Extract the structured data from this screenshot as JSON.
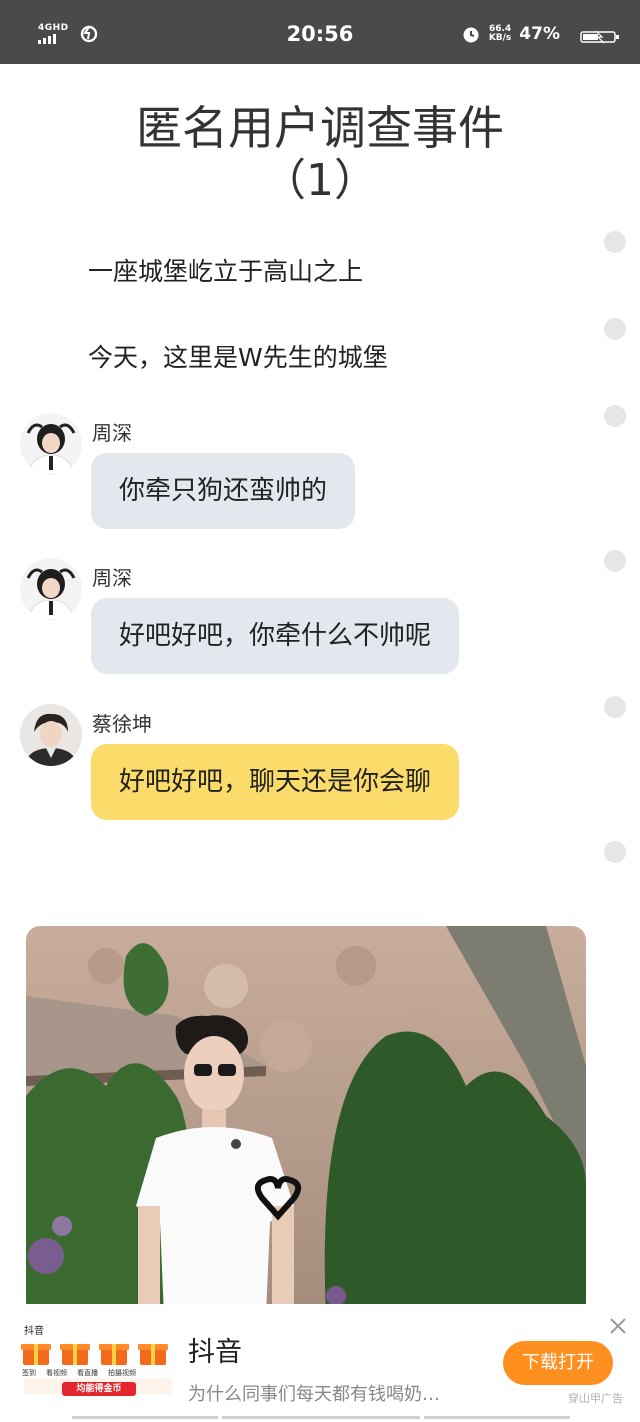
{
  "status_bar": {
    "network": "4GHD",
    "time": "20:56",
    "speed_value": "66.4",
    "speed_unit": "KB/s",
    "battery": "47%"
  },
  "story": {
    "title_line1": "匿名用户调查事件",
    "title_line2": "（1）",
    "narrations": [
      "一座城堡屹立于高山之上",
      "今天，这里是W先生的城堡"
    ],
    "messages": [
      {
        "speaker": "周深",
        "text": "你牵只狗还蛮帅的",
        "style": "gray"
      },
      {
        "speaker": "周深",
        "text": "好吧好吧，你牵什么不帅呢",
        "style": "gray"
      },
      {
        "speaker": "蔡徐坤",
        "text": "好吧好吧，聊天还是你会聊",
        "style": "yellow"
      }
    ]
  },
  "ad": {
    "brand": "抖音",
    "gift_labels": [
      "签到",
      "看视频",
      "看直播",
      "拍摄视频"
    ],
    "banner": "均能得金币",
    "title": "抖音",
    "description": "为什么同事们每天都有钱喝奶…",
    "button": "下载打开",
    "tag": "穿山甲广告"
  },
  "colors": {
    "status_bar_bg": "#4a4a4a",
    "bubble_gray": "#e3e8ee",
    "bubble_yellow": "#fbdc6a",
    "ad_button": "#ff8f1f",
    "ad_banner": "#e3262d"
  }
}
